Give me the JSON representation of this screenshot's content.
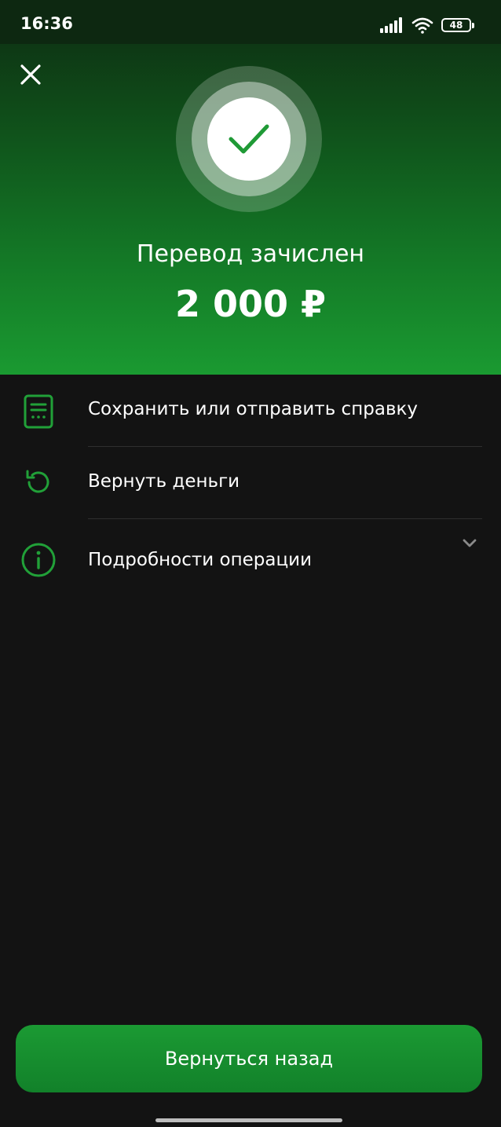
{
  "status_bar": {
    "time": "16:36",
    "battery": "48",
    "icons": [
      "signal-icon",
      "wifi-icon",
      "battery-icon"
    ]
  },
  "header": {
    "close_icon": "close-icon",
    "status_icon": "checkmark-icon",
    "title": "Перевод зачислен",
    "amount": "2 000 ₽"
  },
  "actions": [
    {
      "label": "Сохранить или отправить справку",
      "icon": "document-icon"
    },
    {
      "label": "Вернуть деньги",
      "icon": "refund-icon"
    },
    {
      "label": "Подробности операции",
      "icon": "info-icon"
    }
  ],
  "footer": {
    "back_label": "Вернуться назад"
  },
  "colors": {
    "accent": "#21A038",
    "background": "#131313",
    "divider": "#2F2F2F",
    "button": "#15882C"
  }
}
